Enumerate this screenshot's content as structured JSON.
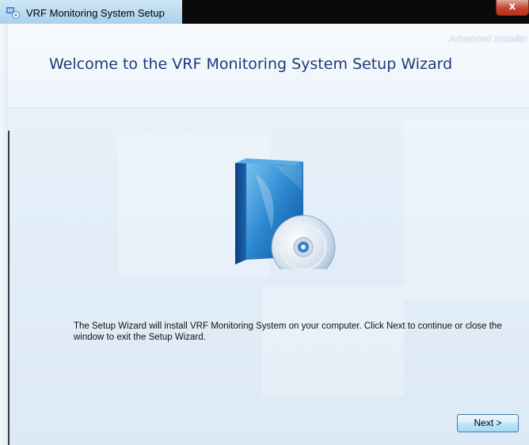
{
  "window": {
    "title": "VRF Monitoring System Setup",
    "close_glyph": "x"
  },
  "header": {
    "watermark": "Advanced Installer",
    "heading": "Welcome to the VRF Monitoring System Setup Wizard"
  },
  "body": {
    "description": "The Setup Wizard will install VRF Monitoring System on your computer. Click Next to continue or close the window to exit the Setup Wizard."
  },
  "buttons": {
    "next_label": "Next >"
  },
  "icons": {
    "app": "installer-app-icon",
    "artwork": "software-box-with-cd-icon"
  },
  "colors": {
    "heading": "#1e3a78",
    "background": "#e3eef8",
    "button_border": "#3c7fb1",
    "close_button": "#c5432c"
  }
}
